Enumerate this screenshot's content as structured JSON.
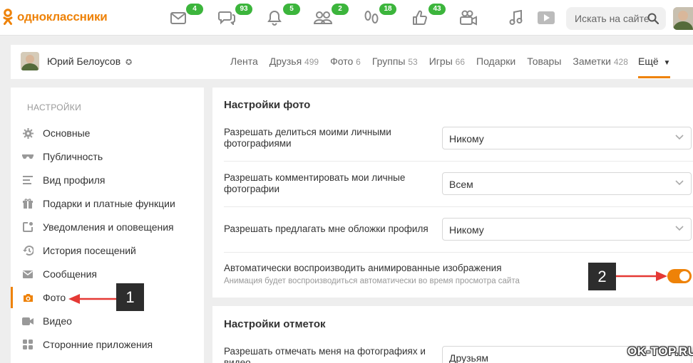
{
  "topbar": {
    "logo_text": "одноклассники",
    "nav": [
      {
        "name": "messages-icon",
        "badge": "4"
      },
      {
        "name": "discussions-icon",
        "badge": "93"
      },
      {
        "name": "notifications-icon",
        "badge": "5"
      },
      {
        "name": "friends-icon",
        "badge": "2"
      },
      {
        "name": "guests-icon",
        "badge": "18"
      },
      {
        "name": "events-icon",
        "badge": "43"
      },
      {
        "name": "video-camera-icon",
        "badge": ""
      },
      {
        "name": "music-icon",
        "badge": ""
      },
      {
        "name": "video-play-icon",
        "badge": ""
      }
    ],
    "search_placeholder": "Искать на сайте"
  },
  "profile": {
    "name": "Юрий Белоусов",
    "tabs": [
      {
        "label": "Лента",
        "count": ""
      },
      {
        "label": "Друзья",
        "count": "499"
      },
      {
        "label": "Фото",
        "count": "6"
      },
      {
        "label": "Группы",
        "count": "53"
      },
      {
        "label": "Игры",
        "count": "66"
      },
      {
        "label": "Подарки",
        "count": ""
      },
      {
        "label": "Товары",
        "count": ""
      },
      {
        "label": "Заметки",
        "count": "428"
      }
    ],
    "more_label": "Ещё"
  },
  "sidebar": {
    "title": "НАСТРОЙКИ",
    "items": [
      {
        "label": "Основные",
        "icon": "gear-icon"
      },
      {
        "label": "Публичность",
        "icon": "glasses-icon"
      },
      {
        "label": "Вид профиля",
        "icon": "profile-view-icon"
      },
      {
        "label": "Подарки и платные функции",
        "icon": "gift-icon"
      },
      {
        "label": "Уведомления и оповещения",
        "icon": "notification-icon"
      },
      {
        "label": "История посещений",
        "icon": "history-icon"
      },
      {
        "label": "Сообщения",
        "icon": "envelope-icon"
      },
      {
        "label": "Фото",
        "icon": "camera-icon",
        "active": true
      },
      {
        "label": "Видео",
        "icon": "video-icon"
      },
      {
        "label": "Сторонние приложения",
        "icon": "apps-icon"
      }
    ]
  },
  "photo_settings": {
    "title": "Настройки фото",
    "rows": [
      {
        "label": "Разрешать делиться моими личными фотографиями",
        "value": "Никому"
      },
      {
        "label": "Разрешать комментировать мои личные фотографии",
        "value": "Всем"
      },
      {
        "label": "Разрешать предлагать мне обложки профиля",
        "value": "Никому"
      }
    ],
    "autoplay_label": "Автоматически воспроизводить анимированные изображения",
    "autoplay_hint": "Анимация будет воспроизводиться автоматически во время просмотра сайта",
    "autoplay_enabled": true
  },
  "tag_settings": {
    "title": "Настройки отметок",
    "row_label": "Разрешать отмечать меня на фотографиях и видео",
    "row_value": "Друзьям"
  },
  "annotations": {
    "marker1": "1",
    "marker2": "2",
    "watermark": "OK-TOP.RU",
    "arrow_color": "#e53935"
  },
  "colors": {
    "accent": "#ee8208",
    "badge": "#3cb53c"
  }
}
